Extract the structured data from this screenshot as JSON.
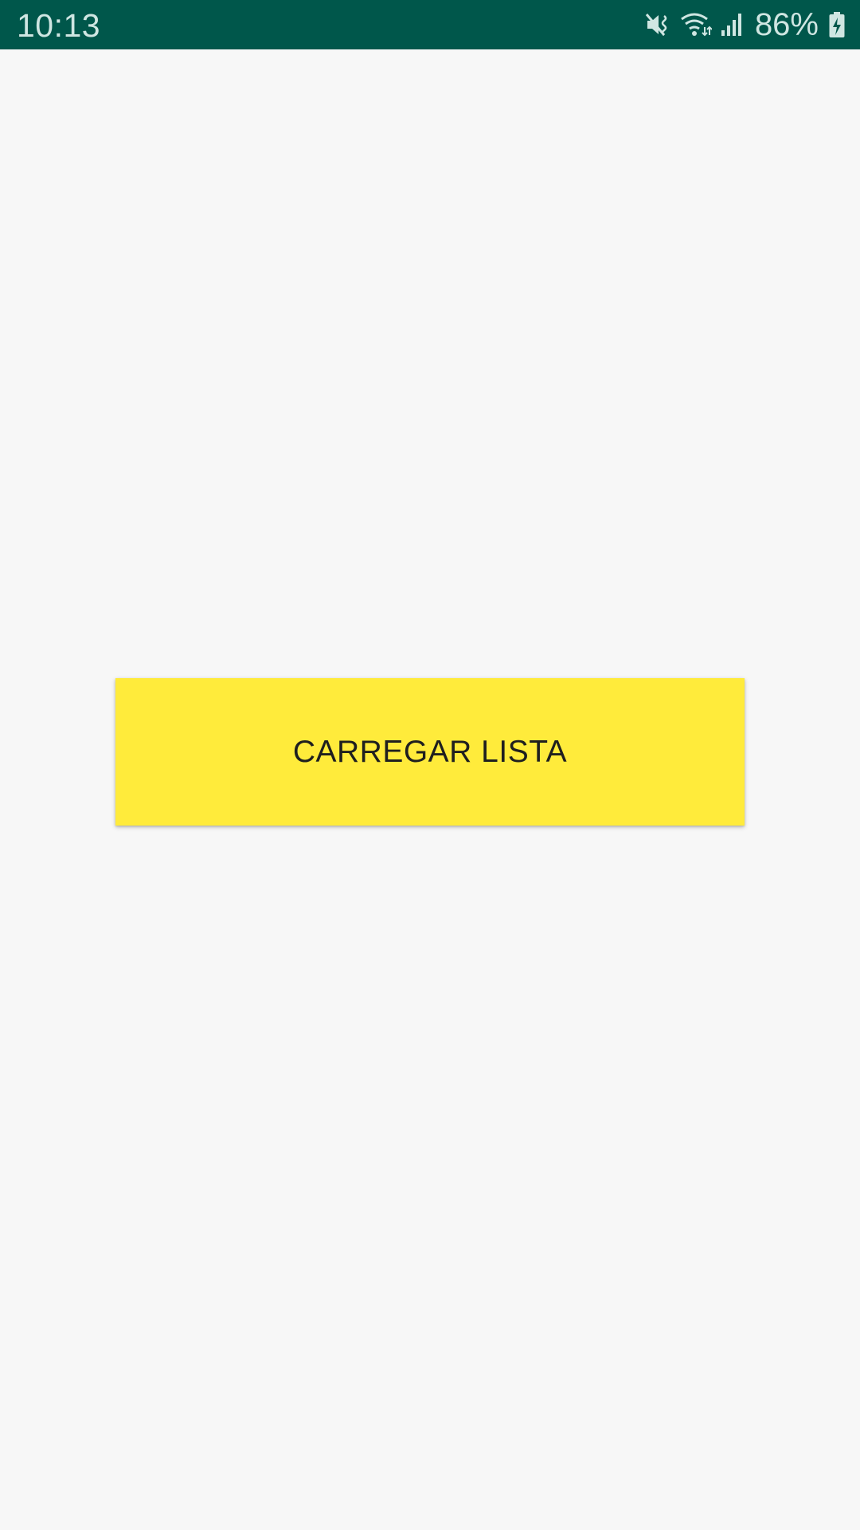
{
  "status_bar": {
    "time": "10:13",
    "battery_percent": "86%",
    "icons": [
      "mute-vibrate-icon",
      "wifi-icon",
      "cell-signal-icon",
      "battery-charging-icon"
    ],
    "background_color": "#00574b"
  },
  "main": {
    "load_button_label": "CARREGAR LISTA",
    "button_color": "#ffeb3b"
  }
}
